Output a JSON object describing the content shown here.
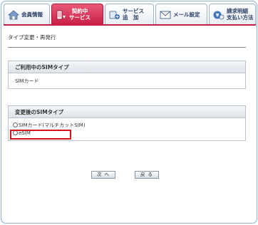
{
  "tabs": [
    {
      "label_lines": [
        "会員情報"
      ],
      "icon": "house-icon",
      "active": false
    },
    {
      "label_lines": [
        "契約中",
        "サービス"
      ],
      "icon": "smartphone-icon",
      "active": true
    },
    {
      "label_lines": [
        "サービス",
        "追　加"
      ],
      "icon": "add-service-icon",
      "active": false
    },
    {
      "label_lines": [
        "メール設定"
      ],
      "icon": "mail-icon",
      "active": false
    },
    {
      "label_lines": [
        "請求明細",
        "支払い方法"
      ],
      "icon": "yen-icon",
      "active": false
    }
  ],
  "page_title": "タイプ変更・再発行",
  "current_sim": {
    "heading": "ご利用中のSIMタイプ",
    "value": "SIMカード"
  },
  "new_sim": {
    "heading": "変更後のSIMタイプ",
    "options": [
      {
        "label": "SIMカード(マルチカットSIM)",
        "selected": false
      },
      {
        "label": "eSIM",
        "selected": false
      }
    ]
  },
  "buttons": {
    "next": "次 へ",
    "back": "戻 る"
  },
  "colors": {
    "active_tab": "#c81e46",
    "highlight": "#d4141c",
    "tab_text": "#2a3f66"
  }
}
